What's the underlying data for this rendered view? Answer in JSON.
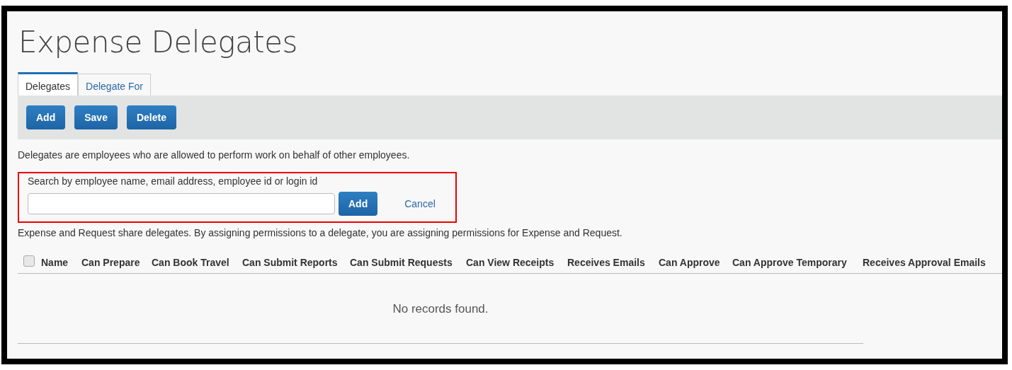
{
  "title": "Expense Delegates",
  "tabs": [
    {
      "label": "Delegates",
      "selected": true
    },
    {
      "label": "Delegate For",
      "selected": false
    }
  ],
  "toolbar": [
    "Add",
    "Save",
    "Delete"
  ],
  "intro": "Delegates are employees who are allowed to perform work on behalf of other employees.",
  "search": {
    "label": "Search by employee name, email address, employee id or login id",
    "add": "Add",
    "cancel": "Cancel"
  },
  "note": "Expense and Request share delegates. By assigning permissions to a delegate, you are assigning permissions for Expense and Request.",
  "table": {
    "select_all": {
      "checked": false
    },
    "columns": [
      {
        "label": "Name"
      },
      {
        "label": "Can Prepare"
      },
      {
        "label": "Can Book Travel"
      },
      {
        "label": "Can Submit Reports"
      },
      {
        "label": "Can Submit Requests"
      },
      {
        "label": "Can View Receipts"
      },
      {
        "label": "Receives Emails"
      },
      {
        "label": "Can Approve"
      },
      {
        "label": "Can Approve Temporary"
      },
      {
        "label": "Receives Approval Emails"
      }
    ],
    "empty": "No records found."
  }
}
